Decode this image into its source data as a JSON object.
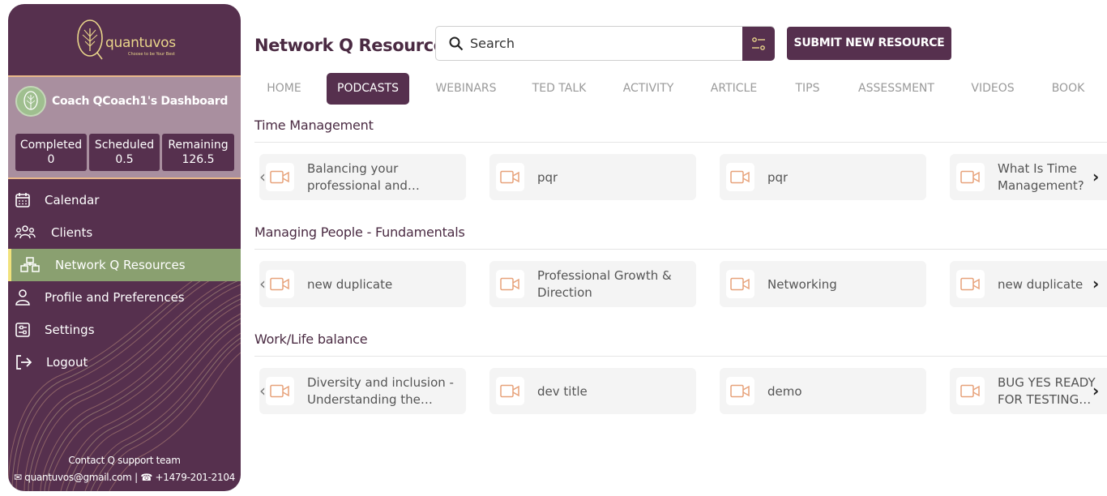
{
  "brand": {
    "name": "quantuvos",
    "tagline": "Choose to be Your Best"
  },
  "dashboard": {
    "title": "Coach QCoach1's Dashboard",
    "stats": [
      {
        "label": "Completed",
        "value": "0"
      },
      {
        "label": "Scheduled",
        "value": "0.5"
      },
      {
        "label": "Remaining",
        "value": "126.5"
      }
    ]
  },
  "nav": [
    {
      "label": "Calendar",
      "icon": "calendar-icon",
      "active": false
    },
    {
      "label": "Clients",
      "icon": "clients-icon",
      "active": false
    },
    {
      "label": "Network Q Resources",
      "icon": "network-icon",
      "active": true
    },
    {
      "label": "Profile and Preferences",
      "icon": "user-icon",
      "active": false
    },
    {
      "label": "Settings",
      "icon": "settings-icon",
      "active": false
    },
    {
      "label": "Logout",
      "icon": "logout-icon",
      "active": false
    }
  ],
  "contact": {
    "heading": "Contact Q support team",
    "email": "quantuvos@gmail.com",
    "phone": "+1479-201-2104"
  },
  "header": {
    "title": "Network Q Resources",
    "search_placeholder": "Search",
    "submit_label": "SUBMIT NEW RESOURCE"
  },
  "tabs": [
    "HOME",
    "PODCASTS",
    "WEBINARS",
    "TED TALK",
    "ACTIVITY",
    "ARTICLE",
    "TIPS",
    "ASSESSMENT",
    "VIDEOS",
    "BOOK"
  ],
  "active_tab": "PODCASTS",
  "sections": [
    {
      "title": "Time Management",
      "items": [
        "Balancing your professional and personal life",
        "pqr",
        "pqr",
        "What Is Time Management?"
      ]
    },
    {
      "title": "Managing People - Fundamentals",
      "items": [
        "new duplicate",
        "Professional Growth & Direction",
        "Networking",
        "new duplicate"
      ]
    },
    {
      "title": "Work/Life balance",
      "items": [
        "Diversity and inclusion - Understanding the basics",
        "dev title",
        "demo",
        "BUG YES READY FOR TESTING Harshal Test"
      ]
    }
  ],
  "colors": {
    "primary": "#56304e",
    "accent_green": "#8aa070",
    "accent_gold": "#e9d58a",
    "video_icon": "#e7a27a"
  }
}
